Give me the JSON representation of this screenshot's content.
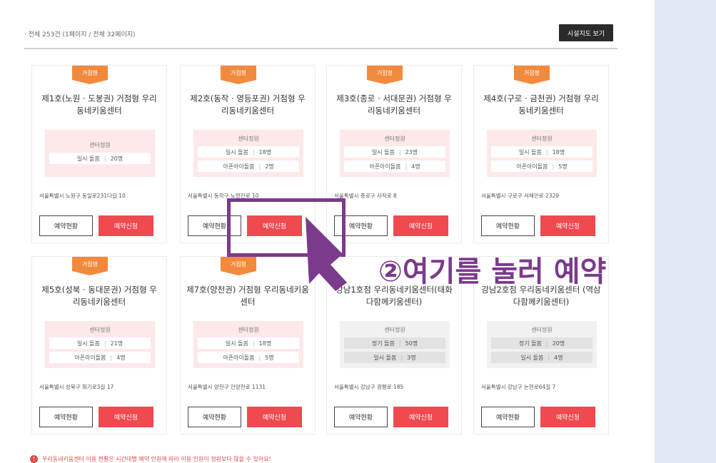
{
  "summary": "· 전체 253건 (1페이지 / 전체 32페이지)",
  "map_button": "시설지도 보기",
  "cards": [
    {
      "badge": "거점형",
      "title": "제1호(노원 · 도봉권) 거점형 우리동네키움센터",
      "capacity_title": "센터정원",
      "rows": [
        {
          "label": "일시 돌봄",
          "value": "20명"
        }
      ],
      "address": "서울특별시 노원구 동일로231다길 10",
      "status": "예약현황",
      "reserve": "예약신청"
    },
    {
      "badge": "거점형",
      "title": "제2호(동작 · 영등포권) 거점형 우리동네키움센터",
      "capacity_title": "센터정원",
      "rows": [
        {
          "label": "일시 돌봄",
          "value": "18명"
        },
        {
          "label": "아픈아이돌봄",
          "value": "2명"
        }
      ],
      "address": "서울특별시 동작구 노량진로 10",
      "status": "예약현황",
      "reserve": "예약신청"
    },
    {
      "badge": "거점형",
      "title": "제3호(종로 · 서대문권) 거점형 우리동네키움센터",
      "capacity_title": "센터정원",
      "rows": [
        {
          "label": "일시 돌봄",
          "value": "23명"
        },
        {
          "label": "아픈아이돌봄",
          "value": "4명"
        }
      ],
      "address": "서울특별시 종로구 사직로 8",
      "status": "예약현황",
      "reserve": "예약신청"
    },
    {
      "badge": "거점형",
      "title": "제4호(구로 · 금천권) 거점형 우리동네키움센터",
      "capacity_title": "센터정원",
      "rows": [
        {
          "label": "일시 돌봄",
          "value": "18명"
        },
        {
          "label": "아픈아이돌봄",
          "value": "5명"
        }
      ],
      "address": "서울특별시 구로구 서해안로 2329",
      "status": "예약현황",
      "reserve": "예약신청"
    },
    {
      "badge": "거점형",
      "title": "제5호(성북 · 동대문권) 거점형 우리동네키움센터",
      "capacity_title": "센터정원",
      "rows": [
        {
          "label": "일시 돌봄",
          "value": "21명"
        },
        {
          "label": "아픈아이돌봄",
          "value": "4명"
        }
      ],
      "address": "서울특별시 성북구 화기로3길 17",
      "status": "예약현황",
      "reserve": "예약신청"
    },
    {
      "badge": "거점형",
      "title": "제7호(양천권) 거점형 우리동네키움센터",
      "capacity_title": "센터정원",
      "rows": [
        {
          "label": "일시 돌봄",
          "value": "18명"
        },
        {
          "label": "아픈아이돌봄",
          "value": "5명"
        }
      ],
      "address": "서울특별시 양천구 안양천로 1131",
      "status": "예약현황",
      "reserve": "예약신청"
    },
    {
      "badge": "",
      "title": "강남1호점 우리동네키움센터(태화다함께키움센터)",
      "capacity_title": "센터정원",
      "rows": [
        {
          "label": "정기 돌봄",
          "value": "50명"
        },
        {
          "label": "일시 돌봄",
          "value": "3명"
        }
      ],
      "address": "서울특별시 강남구 광평로 185",
      "status": "예약현황",
      "reserve": "예약신청"
    },
    {
      "badge": "",
      "title": "강남2호점 우리동네키움센터 (역삼다함께키움센터)",
      "capacity_title": "센터정원",
      "rows": [
        {
          "label": "정기 돌봄",
          "value": "20명"
        },
        {
          "label": "일시 돌봄",
          "value": "4명"
        }
      ],
      "address": "서울특별시 강남구 논현로64길 7",
      "status": "예약현황",
      "reserve": "예약신청"
    }
  ],
  "notice": "우리동네키움센터 이용 현황은 시간대별 예약 인원에 따라 이용 인원이 정원보다 많을 수 있어요!",
  "annotation": "②여기를 눌러 예약",
  "colors": {
    "accent": "#ee4a4f",
    "badge": "#f28a3d",
    "annotation": "#7b3a8c",
    "panel": "#dfe8f4"
  }
}
